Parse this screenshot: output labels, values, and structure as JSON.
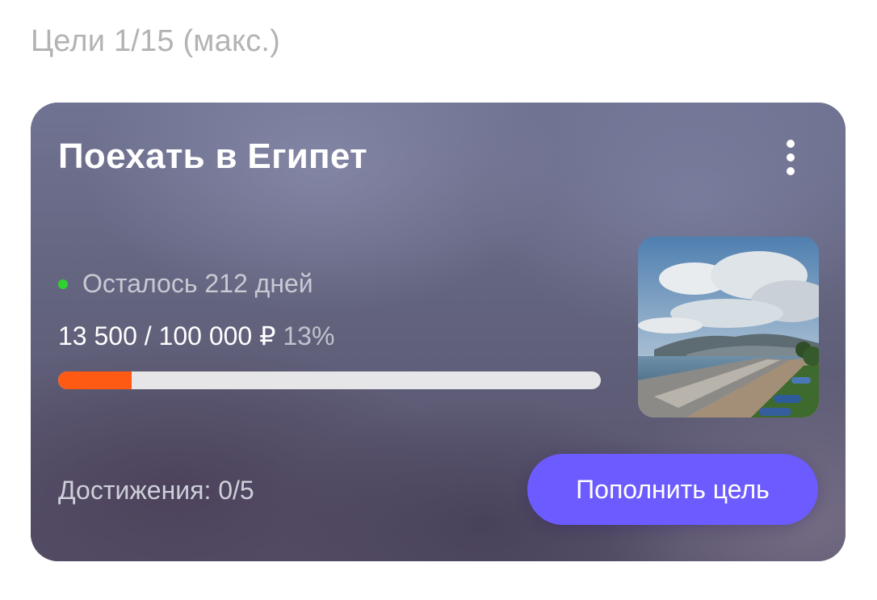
{
  "goals_section": {
    "title": "Цели 1/15 (макс.)"
  },
  "goal_card": {
    "title": "Поехать в Египет",
    "status_text": "Осталось 212 дней",
    "amount_text": "13 500 / 100 000 ₽",
    "percent_text": "13%",
    "progress_fraction": 0.135,
    "achievements_text": "Достижения: 0/5",
    "topup_label": "Пополнить цель",
    "menu_icon": "more-vertical-icon",
    "image_icon": "seaside-promenade-photo"
  },
  "colors": {
    "status_dot": "#2fd12f",
    "progress_fill": "#ff5a14",
    "progress_track": "#e6e6e9",
    "button_bg": "#6c5cff",
    "section_title": "#b3b3b6"
  }
}
